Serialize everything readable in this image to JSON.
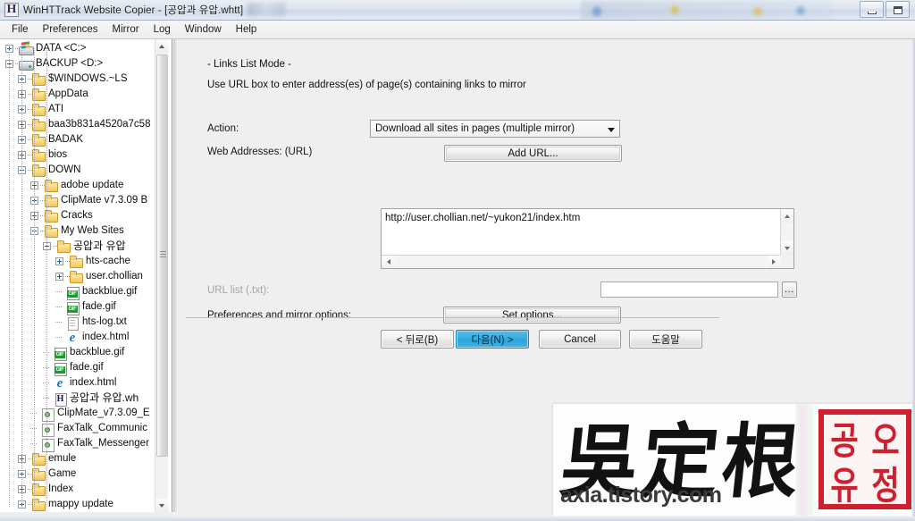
{
  "window": {
    "title": "WinHTTrack Website Copier - [공압과 유압.whtt]",
    "app_icon": "htt-document-icon",
    "buttons": [
      {
        "name": "minimize",
        "glyph": "minimize-icon"
      },
      {
        "name": "maximize",
        "glyph": "maximize-icon"
      }
    ]
  },
  "menubar": {
    "items": [
      {
        "label": "File"
      },
      {
        "label": "Preferences"
      },
      {
        "label": "Mirror"
      },
      {
        "label": "Log"
      },
      {
        "label": "Window"
      },
      {
        "label": "Help"
      }
    ]
  },
  "tree": {
    "scrollbar": {
      "up_icon": "triangle-up-icon",
      "down_icon": "triangle-down-icon",
      "grip_icon": "grip-icon"
    },
    "nodes": [
      {
        "label": "DATA <C:>",
        "indent": 0,
        "expander": "plus",
        "icon": "drive-windows-icon"
      },
      {
        "label": "BACKUP <D:>",
        "indent": 0,
        "expander": "minus",
        "icon": "drive-icon"
      },
      {
        "label": "$WINDOWS.~LS",
        "indent": 1,
        "expander": "plus",
        "icon": "folder-icon"
      },
      {
        "label": "AppData",
        "indent": 1,
        "expander": "plus",
        "icon": "folder-icon"
      },
      {
        "label": "ATI",
        "indent": 1,
        "expander": "plus",
        "icon": "folder-icon"
      },
      {
        "label": "baa3b831a4520a7c58",
        "indent": 1,
        "expander": "plus",
        "icon": "folder-icon"
      },
      {
        "label": "BADAK",
        "indent": 1,
        "expander": "plus",
        "icon": "folder-icon"
      },
      {
        "label": "bios",
        "indent": 1,
        "expander": "plus",
        "icon": "folder-icon"
      },
      {
        "label": "DOWN",
        "indent": 1,
        "expander": "minus",
        "icon": "folder-icon"
      },
      {
        "label": "adobe update",
        "indent": 2,
        "expander": "plus",
        "icon": "folder-icon"
      },
      {
        "label": "ClipMate v7.3.09 B",
        "indent": 2,
        "expander": "plus",
        "icon": "folder-icon"
      },
      {
        "label": "Cracks",
        "indent": 2,
        "expander": "plus",
        "icon": "folder-icon"
      },
      {
        "label": "My Web Sites",
        "indent": 2,
        "expander": "minus",
        "icon": "folder-icon"
      },
      {
        "label": "공압과 유압",
        "indent": 3,
        "expander": "minus",
        "icon": "folder-icon",
        "korean": true
      },
      {
        "label": "hts-cache",
        "indent": 4,
        "expander": "plus",
        "icon": "folder-icon"
      },
      {
        "label": "user.chollian",
        "indent": 4,
        "expander": "plus",
        "icon": "folder-icon"
      },
      {
        "label": "backblue.gif",
        "indent": 4,
        "expander": "none",
        "icon": "gif-file-icon"
      },
      {
        "label": "fade.gif",
        "indent": 4,
        "expander": "none",
        "icon": "gif-file-icon"
      },
      {
        "label": "hts-log.txt",
        "indent": 4,
        "expander": "none",
        "icon": "text-file-icon"
      },
      {
        "label": "index.html",
        "indent": 4,
        "expander": "none",
        "icon": "html-file-icon"
      },
      {
        "label": "backblue.gif",
        "indent": 3,
        "expander": "none",
        "icon": "gif-file-icon"
      },
      {
        "label": "fade.gif",
        "indent": 3,
        "expander": "none",
        "icon": "gif-file-icon"
      },
      {
        "label": "index.html",
        "indent": 3,
        "expander": "none",
        "icon": "html-file-icon"
      },
      {
        "label": "공압과 유압.wh",
        "indent": 3,
        "expander": "none",
        "icon": "whtt-file-icon",
        "korean": true
      },
      {
        "label": "ClipMate_v7.3.09_E",
        "indent": 2,
        "expander": "none",
        "icon": "exe-file-icon"
      },
      {
        "label": "FaxTalk_Communic",
        "indent": 2,
        "expander": "none",
        "icon": "exe-file-icon"
      },
      {
        "label": "FaxTalk_Messenger",
        "indent": 2,
        "expander": "none",
        "icon": "exe-file-icon"
      },
      {
        "label": "emule",
        "indent": 1,
        "expander": "plus",
        "icon": "folder-icon"
      },
      {
        "label": "Game",
        "indent": 1,
        "expander": "plus",
        "icon": "folder-icon"
      },
      {
        "label": "Index",
        "indent": 1,
        "expander": "plus",
        "icon": "folder-icon"
      },
      {
        "label": "mappy update",
        "indent": 1,
        "expander": "plus",
        "icon": "folder-icon"
      }
    ]
  },
  "wizard": {
    "mode_heading": "- Links List Mode -",
    "mode_subtext": "Use URL box to enter address(es) of page(s) containing links to mirror",
    "action_label": "Action:",
    "action_value": "Download all sites in pages (multiple mirror)",
    "action_options": [
      "Download all sites in pages (multiple mirror)"
    ],
    "web_addresses_label": "Web Addresses: (URL)",
    "add_url_label": "Add URL...",
    "url_value": "http://user.chollian.net/~yukon21/index.htm",
    "url_list_label": "URL list (.txt):",
    "url_list_value": "",
    "browse_label": "...",
    "options_label": "Preferences and mirror options:",
    "set_options_label": "Set options...",
    "nav": {
      "back": "< 뒤로(B)",
      "next": "다음(N) >",
      "cancel": "Cancel",
      "help": "도움말"
    }
  },
  "watermark": {
    "cjk_text": "吳定根",
    "url": "axia.tistory.com",
    "seal_chars": [
      "공",
      "오",
      "유",
      "정"
    ],
    "seal_color": "#cf2030"
  },
  "colors": {
    "focus_accent": "#2aa3dd",
    "panel_bg": "#efefef",
    "tree_bg": "#ffffff",
    "titlebar_bg": "#dbe4ef"
  }
}
